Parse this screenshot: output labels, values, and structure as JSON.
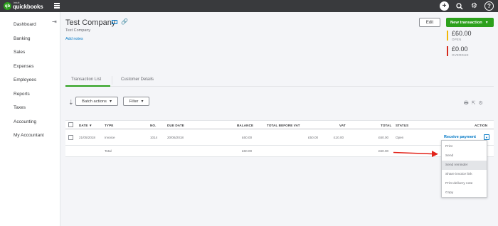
{
  "app": {
    "logo_brand": "quickbooks",
    "logo_intuit": "intuit",
    "brand_color": "#2ca01c",
    "link_color": "#0077c5",
    "topbar_color": "#393a3d"
  },
  "top_icons": [
    "plus-icon",
    "search-icon",
    "gear-icon",
    "help-icon"
  ],
  "sidebar": {
    "items": [
      {
        "label": "Dashboard"
      },
      {
        "label": "Banking"
      },
      {
        "label": "Sales"
      },
      {
        "label": "Expenses"
      },
      {
        "label": "Employees"
      },
      {
        "label": "Reports"
      },
      {
        "label": "Taxes"
      },
      {
        "label": "Accounting"
      },
      {
        "label": "My Accountant"
      }
    ]
  },
  "customer": {
    "name": "Test Company",
    "subtitle": "Test Company",
    "add_notes": "Add notes"
  },
  "actions": {
    "edit_label": "Edit",
    "new_transaction_label": "New transaction"
  },
  "stats": {
    "open_amount": "£60.00",
    "open_label": "OPEN",
    "open_color": "#f2b705",
    "overdue_amount": "£0.00",
    "overdue_label": "OVERDUE",
    "overdue_color": "#d52b1e"
  },
  "tabs": [
    {
      "label": "Transaction List",
      "active": true
    },
    {
      "label": "Customer Details",
      "active": false
    }
  ],
  "toolbar": {
    "batch_actions_label": "Batch actions",
    "filter_label": "Filter"
  },
  "table": {
    "headers": {
      "date": "DATE",
      "type": "TYPE",
      "no": "NO.",
      "due_date": "DUE DATE",
      "balance": "BALANCE",
      "total_before_vat": "TOTAL BEFORE VAT",
      "vat": "VAT",
      "total": "TOTAL",
      "status": "STATUS",
      "action": "ACTION"
    },
    "rows": [
      {
        "date": "21/05/2018",
        "type": "Invoice",
        "no": "1014",
        "due_date": "20/06/2018",
        "balance": "£60.00",
        "total_before_vat": "£50.00",
        "vat": "£10.00",
        "total": "£60.00",
        "status": "Open",
        "action": "Receive payment"
      }
    ],
    "total_row": {
      "label": "Total",
      "balance": "£60.00",
      "total": "£60.00"
    }
  },
  "action_menu": {
    "items": [
      {
        "label": "Print"
      },
      {
        "label": "Send"
      },
      {
        "label": "Send reminder",
        "highlighted": true
      },
      {
        "label": "Share invoice link"
      },
      {
        "label": "Print delivery note"
      },
      {
        "label": "Copy"
      }
    ]
  }
}
